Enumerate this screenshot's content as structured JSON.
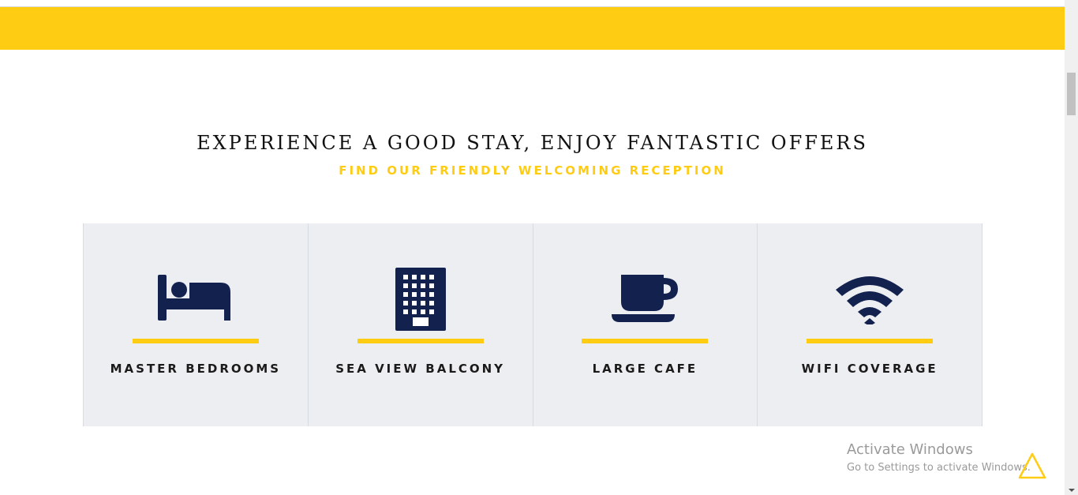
{
  "header": {
    "band_color": "#ffcc14"
  },
  "section": {
    "title": "EXPERIENCE A GOOD STAY, ENJOY FANTASTIC OFFERS",
    "subtitle": "FIND OUR FRIENDLY WELCOMING RECEPTION"
  },
  "features": [
    {
      "label": "MASTER BEDROOMS",
      "icon": "bed-icon"
    },
    {
      "label": "SEA VIEW BALCONY",
      "icon": "building-icon"
    },
    {
      "label": "LARGE CAFE",
      "icon": "coffee-cup-icon"
    },
    {
      "label": "WIFI COVERAGE",
      "icon": "wifi-icon"
    }
  ],
  "colors": {
    "accent": "#ffcc14",
    "icon": "#13214f",
    "card_bg": "#edeef1"
  },
  "watermark": {
    "title": "Activate Windows",
    "subtitle": "Go to Settings to activate Windows."
  }
}
